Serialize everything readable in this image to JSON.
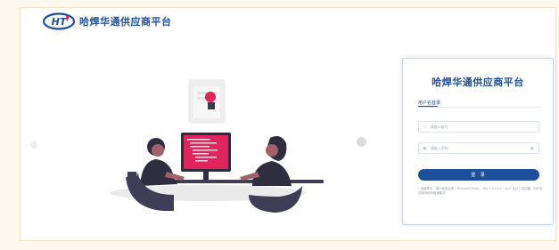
{
  "header": {
    "logo_text": "HT",
    "brand_title": "哈焊华通供应商平台"
  },
  "login_card": {
    "title": "哈焊华通供应商平台",
    "tab_label": "用户名登录",
    "username_placeholder": "请输入账号",
    "password_placeholder": "请输入密码",
    "login_button": "登 录",
    "note": "* 温馨提示：建议使用谷歌、Microsoft Edge、360 7.0 / 9.0 / 10.0 及以上浏览器，360浏览器请使用极速模式"
  },
  "colors": {
    "brand_blue": "#1f4f9a",
    "page_bg": "#fdf8ee",
    "screen_red": "#e0245e"
  }
}
